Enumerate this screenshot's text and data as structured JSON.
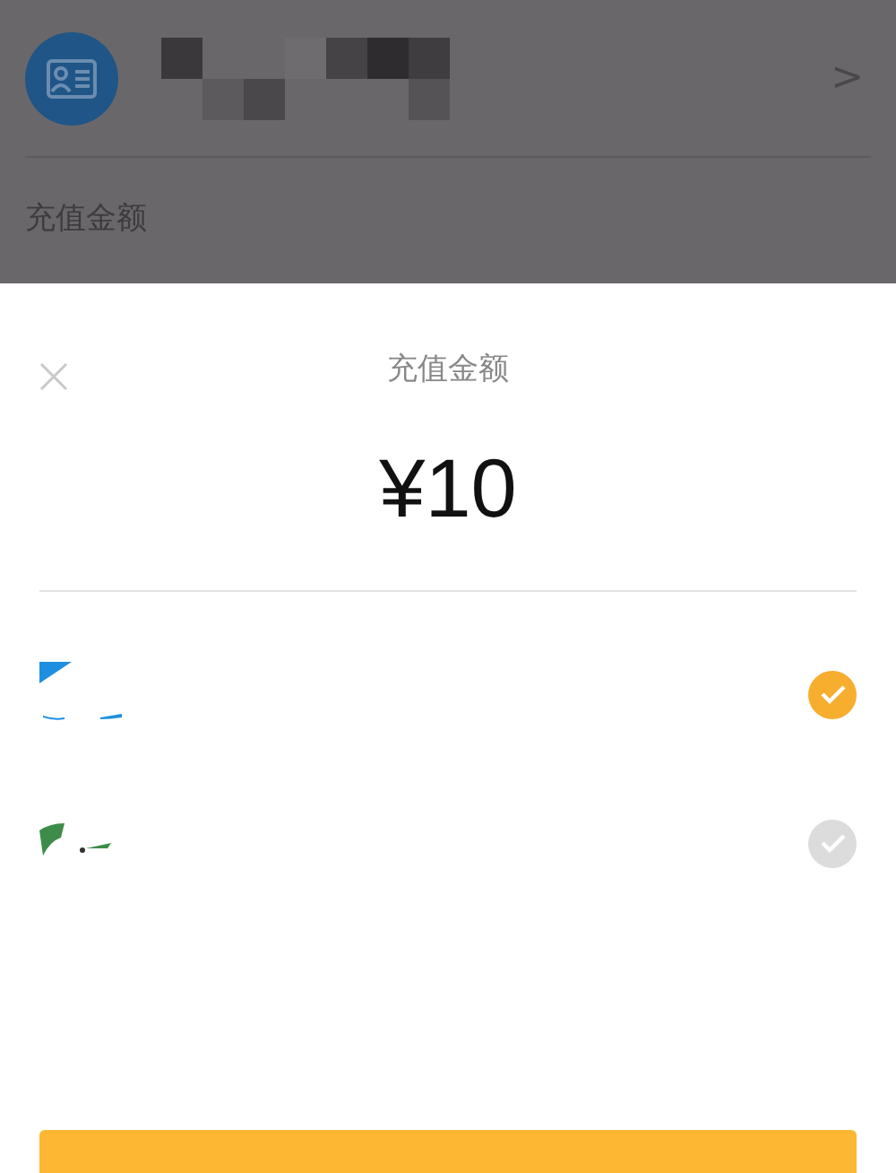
{
  "background": {
    "chevron": ">",
    "section_label": "充值金额"
  },
  "sheet": {
    "title": "充值金额",
    "amount": "¥10"
  },
  "payment_options": [
    {
      "kind": "blue",
      "selected": true
    },
    {
      "kind": "green",
      "selected": false
    }
  ]
}
